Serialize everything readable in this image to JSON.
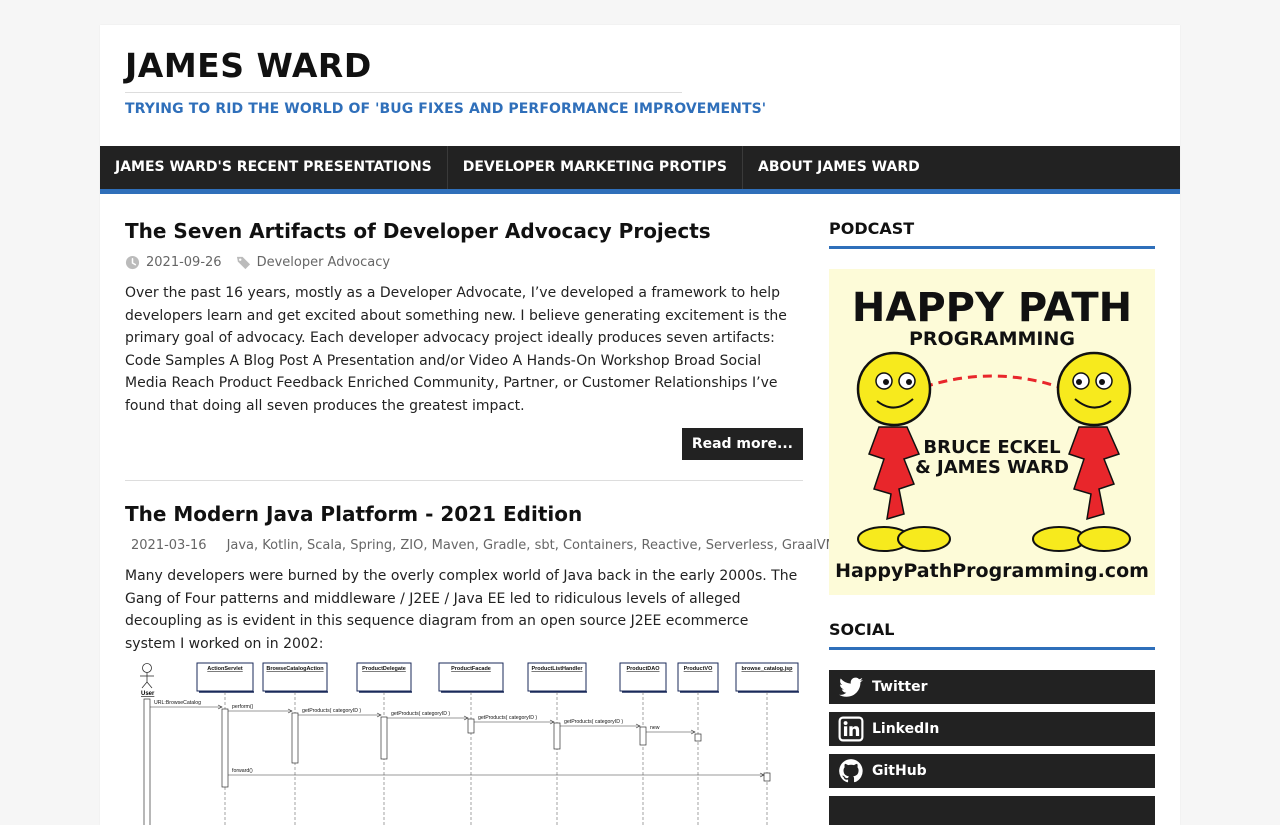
{
  "site": {
    "title": "JAMES WARD",
    "description": "TRYING TO RID THE WORLD OF 'BUG FIXES AND PERFORMANCE IMPROVEMENTS'"
  },
  "nav": [
    {
      "label": "JAMES WARD'S RECENT PRESENTATIONS"
    },
    {
      "label": "DEVELOPER MARKETING PROTIPS"
    },
    {
      "label": "ABOUT JAMES WARD"
    }
  ],
  "posts": [
    {
      "title": "The Seven Artifacts of Developer Advocacy Projects",
      "date": "2021-09-26",
      "tags": [
        "Developer Advocacy"
      ],
      "excerpt": "Over the past 16 years, mostly as a Developer Advocate, I’ve developed a framework to help developers learn and get excited about something new. I believe generating excitement is the primary goal of advocacy. Each developer advocacy project ideally produces seven artifacts: Code Samples A Blog Post A Presentation and/or Video A Hands-On Workshop Broad Social Media Reach Product Feedback Enriched Community, Partner, or Customer Relationships I’ve found that doing all seven produces the greatest impact.",
      "read_more": "Read more..."
    },
    {
      "title": "The Modern Java Platform - 2021 Edition",
      "date": "2021-03-16",
      "tags": [
        "Java",
        "Kotlin",
        "Scala",
        "Spring",
        "ZIO",
        "Maven",
        "Gradle",
        "sbt",
        "Containers",
        "Reactive",
        "Serverless",
        "GraalVM"
      ],
      "excerpt": "Many developers were burned by the overly complex world of Java back in the early 2000s. The Gang of Four patterns and middleware / J2EE / Java EE led to ridiculous levels of alleged decoupling as is evident in this sequence diagram from an open source J2EE ecommerce system I worked on in 2002:"
    }
  ],
  "diagram": {
    "actor": "User",
    "lifelines": [
      "ActionServlet",
      "BrowseCatalogAction",
      "ProductDelegate",
      "ProductFacade",
      "ProductListHandler",
      "ProductDAO",
      "ProductVO",
      "browse_catalog.jsp"
    ],
    "messages": [
      "URL:BrowseCatalog",
      "perform()",
      "getProducts( categoryID )",
      "getProducts( categoryID )",
      "getProducts( categoryID )",
      "getProducts( categoryID )",
      "new",
      "forward()"
    ]
  },
  "sidebar": {
    "podcast_title": "PODCAST",
    "podcast": {
      "line1": "HAPPY PATH",
      "line2": "PROGRAMMING",
      "hosts1": "BRUCE ECKEL",
      "hosts2": "& JAMES WARD",
      "url": "HappyPathProgramming.com"
    },
    "social_title": "SOCIAL",
    "social": [
      {
        "label": "Twitter",
        "icon": "twitter-icon"
      },
      {
        "label": "LinkedIn",
        "icon": "linkedin-icon"
      },
      {
        "label": "GitHub",
        "icon": "github-icon"
      }
    ]
  },
  "colors": {
    "accent": "#2f6fba",
    "dark": "#222222",
    "podcast_bg": "#fdfbd8",
    "podcast_red": "#e8262b",
    "podcast_yellow": "#f7ea1d"
  }
}
